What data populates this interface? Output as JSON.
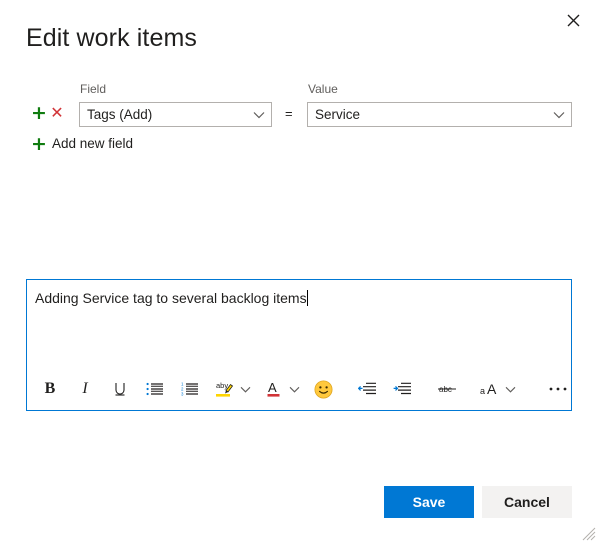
{
  "dialog": {
    "title": "Edit work items",
    "close_icon": "close-icon"
  },
  "clause_editor": {
    "column_headers": {
      "field": "Field",
      "value": "Value"
    },
    "operator": "=",
    "rows": [
      {
        "add_icon": "plus-icon",
        "remove_icon": "cross-icon",
        "field": "Tags (Add)",
        "field_caret_icon": "chevron-down-icon",
        "value": "Service",
        "value_caret_icon": "chevron-down-icon"
      }
    ],
    "add_new_field": {
      "icon": "plus-icon",
      "label": "Add new field"
    }
  },
  "comment_editor": {
    "text": "Adding Service tag to several backlog items",
    "toolbar": [
      {
        "name": "bold-icon",
        "label": "B"
      },
      {
        "name": "italic-icon",
        "label": "I"
      },
      {
        "name": "underline-icon",
        "label": "U"
      },
      {
        "name": "bulleted-list-icon",
        "label": ""
      },
      {
        "name": "numbered-list-icon",
        "label": ""
      },
      {
        "name": "highlight-color-icon",
        "label": "aby"
      },
      {
        "name": "highlight-color-caret-icon",
        "label": ""
      },
      {
        "name": "font-color-icon",
        "label": "A"
      },
      {
        "name": "font-color-caret-icon",
        "label": ""
      },
      {
        "name": "emoji-icon",
        "label": ""
      },
      {
        "name": "decrease-indent-icon",
        "label": ""
      },
      {
        "name": "increase-indent-icon",
        "label": ""
      },
      {
        "name": "strikethrough-icon",
        "label": "abc"
      },
      {
        "name": "font-size-icon",
        "label": "aA"
      },
      {
        "name": "font-size-caret-icon",
        "label": ""
      },
      {
        "name": "more-options-icon",
        "label": ""
      }
    ]
  },
  "footer": {
    "save_label": "Save",
    "cancel_label": "Cancel"
  },
  "colors": {
    "accent": "#0078d4",
    "add": "#107c10",
    "remove": "#d13438",
    "highlight": "#ffd500",
    "font_color_bar": "#d13438",
    "secondary_button": "#f3f2f1",
    "label_text": "#605e5c",
    "emoji": "#ffc83d"
  }
}
